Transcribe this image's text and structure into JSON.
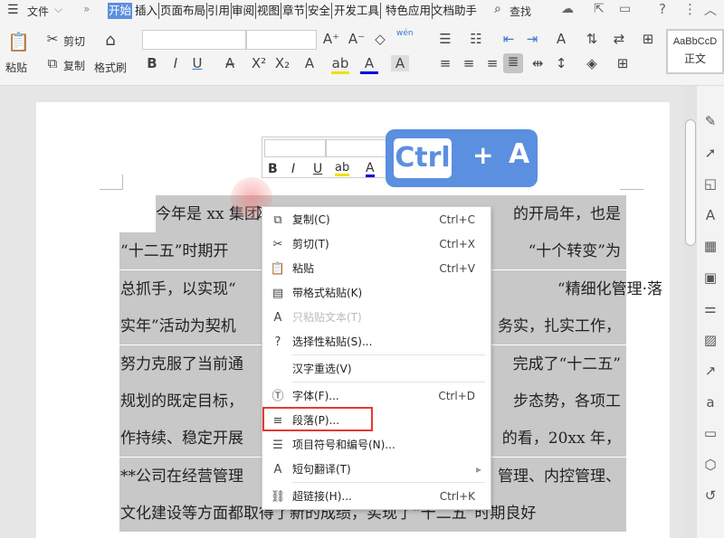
{
  "menu_bar": {
    "file": "文件",
    "tabs": [
      "开始",
      "插入",
      "页面布局",
      "引用",
      "审阅",
      "视图",
      "章节",
      "安全",
      "开发工具",
      "特色应用",
      "文档助手"
    ],
    "active_tab": "开始",
    "search": "查找"
  },
  "ribbon": {
    "paste": "粘贴",
    "cut": "剪切",
    "copy": "复制",
    "format_painter": "格式刷",
    "phonetic": "wén",
    "style_preview": "AaBbCcD",
    "style_name": "正文"
  },
  "shortcut_badge": {
    "key1": "Ctrl",
    "plus": "+",
    "key2": "A"
  },
  "document": {
    "lines": [
      {
        "left": "今年是 xx 集团",
        "right": "的开局年，也是"
      },
      {
        "left": "“十二五”时期开",
        "right": "“十个转变”为"
      },
      {
        "left": "总抓手，以实现“",
        "right": "“精细化管理·落"
      },
      {
        "left": "实年”活动为契机",
        "right": "务实，扎实工作，"
      },
      {
        "left": "努力克服了当前通",
        "right": "完成了“十二五”"
      },
      {
        "left": "规划的既定目标，",
        "right": "步态势，各项工"
      },
      {
        "left": "作持续、稳定开展",
        "right": "的看，20xx 年，"
      },
      {
        "left": "**公司在经营管理",
        "right": "管理、内控管理、"
      },
      {
        "left": "文化建设等方面都取得了新的成绩，实现了“十二五”时期良好",
        "right": ""
      }
    ]
  },
  "context_menu": {
    "items": [
      {
        "label": "复制(C)",
        "shortcut": "Ctrl+C"
      },
      {
        "label": "剪切(T)",
        "shortcut": "Ctrl+X"
      },
      {
        "label": "粘贴",
        "shortcut": "Ctrl+V"
      },
      {
        "label": "带格式粘贴(K)",
        "shortcut": ""
      },
      {
        "label": "只粘贴文本(T)",
        "shortcut": ""
      },
      {
        "label": "选择性粘贴(S)...",
        "shortcut": ""
      },
      {
        "label": "汉字重选(V)",
        "shortcut": ""
      },
      {
        "label": "字体(F)...",
        "shortcut": "Ctrl+D"
      },
      {
        "label": "段落(P)...",
        "shortcut": ""
      },
      {
        "label": "项目符号和编号(N)...",
        "shortcut": ""
      },
      {
        "label": "短句翻译(T)",
        "shortcut": ""
      },
      {
        "label": "超链接(H)...",
        "shortcut": "Ctrl+K"
      }
    ]
  },
  "colors": {
    "accent": "#5b8fe0",
    "highlight_box": "#e53935",
    "selection": "#c8c8c8"
  }
}
